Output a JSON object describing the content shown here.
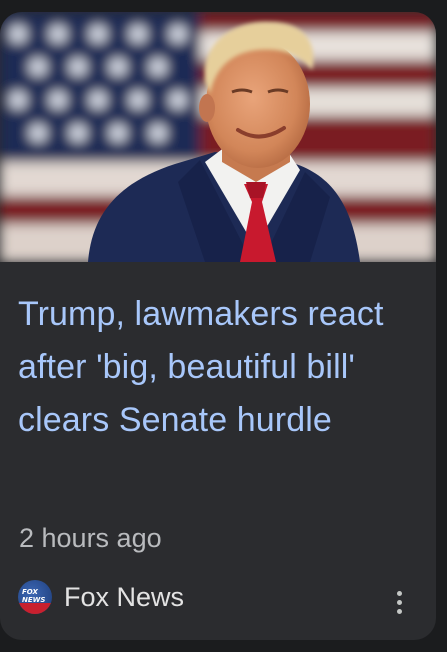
{
  "card": {
    "image_alt": "Donald Trump smiling in front of an American flag",
    "headline": "Trump, lawmakers react after 'big, beautiful bill' clears Senate hurdle",
    "timestamp": "2 hours ago",
    "source": {
      "name": "Fox News",
      "logo_icon": "fox-news-logo-icon",
      "logo_text": "FOX NEWS"
    },
    "more_icon": "more-vert-icon"
  },
  "colors": {
    "background": "#1b1c1e",
    "card": "#2b2c2f",
    "headline": "#a8c7fa",
    "timestamp": "#b9bbbe",
    "source_text": "#e3e3e3"
  }
}
